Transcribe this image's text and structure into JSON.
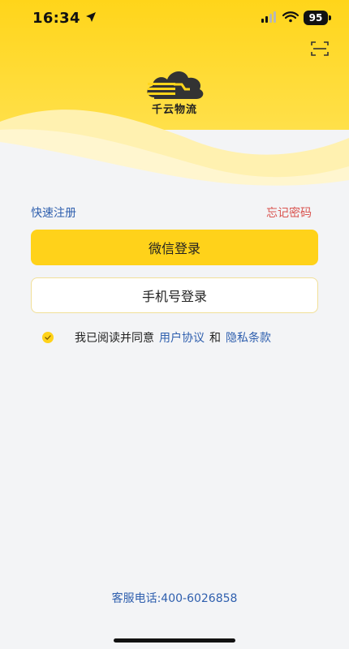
{
  "status_bar": {
    "time": "16:34",
    "battery": "95"
  },
  "brand": {
    "name": "千云物流"
  },
  "links": {
    "register": "快速注册",
    "forgot_password": "忘记密码"
  },
  "buttons": {
    "wechat_login": "微信登录",
    "phone_login": "手机号登录"
  },
  "agreement": {
    "prefix": "我已阅读并同意",
    "user_agreement": "用户协议",
    "and": "和",
    "privacy_policy": "隐私条款",
    "checked": true
  },
  "footer": {
    "service_phone": "客服电话:400-6026858"
  },
  "colors": {
    "brand_yellow": "#ffd21a",
    "link_blue": "#2f5fae",
    "link_red": "#d9534f",
    "background": "#f3f4f6"
  }
}
